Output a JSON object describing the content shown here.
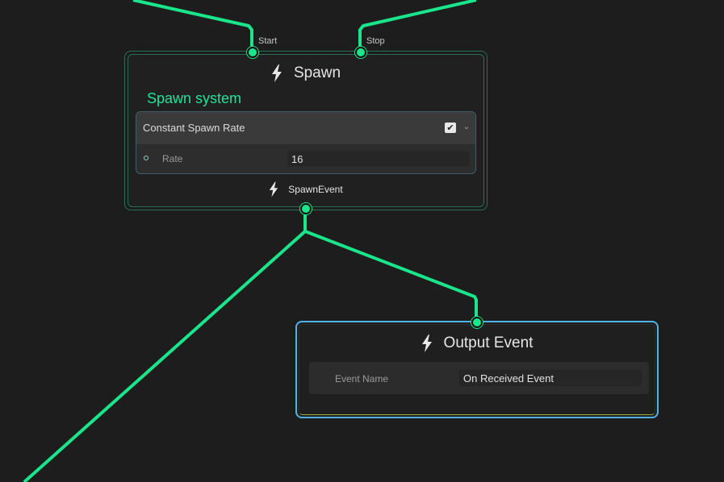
{
  "spawn_node": {
    "title": "Spawn",
    "subtitle": "Spawn system",
    "flow_inputs": {
      "start_label": "Start",
      "stop_label": "Stop"
    },
    "block": {
      "title": "Constant Spawn Rate",
      "enabled": true,
      "check_glyph": "✔",
      "chevron_glyph": "⌄",
      "rate_label": "Rate",
      "rate_value": "16"
    },
    "output_label": "SpawnEvent"
  },
  "output_event_node": {
    "title": "Output Event",
    "event_name_label": "Event Name",
    "event_name_value": "On Received Event"
  },
  "colors": {
    "flow_wire": "#19e58a",
    "selection_outline": "#4fb3ea",
    "subtitle": "#1de49a",
    "background": "#1d1d1d"
  },
  "icons": {
    "node_icon": "lightning-bolt-icon"
  }
}
